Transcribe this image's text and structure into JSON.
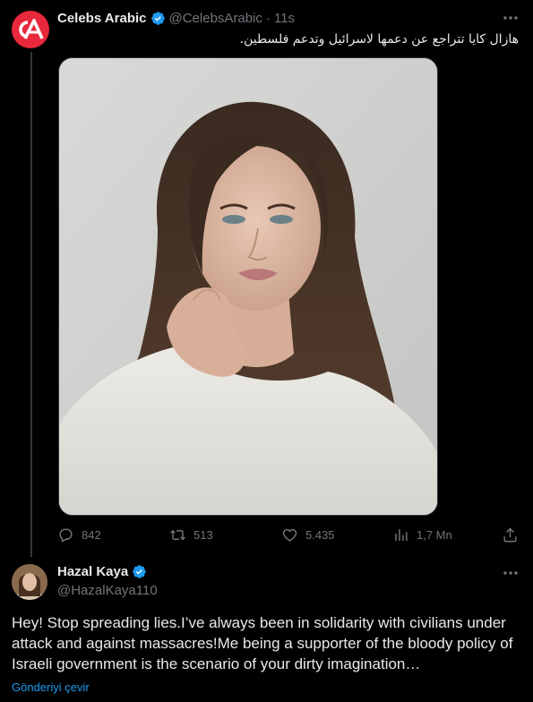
{
  "colors": {
    "background": "#000000",
    "text_primary": "#e7e9ea",
    "text_muted": "#71767b",
    "accent_blue": "#1d9bf0",
    "verified_badge": "#1d9bf0",
    "brand_red": "#e8283b"
  },
  "tweet": {
    "author_name": "Celebs Arabic",
    "author_handle": "@CelebsArabic",
    "separator": "·",
    "time": "11s",
    "avatar_logo_text": "CA",
    "text": "هازال كايا تتراجع عن دعمها لاسرائيل وتدعم فلسطين.",
    "media": {
      "alt": "Portrait photo of a woman with long brown hair in a cream sweater, hand at her chin"
    },
    "stats": {
      "replies": "842",
      "retweets": "513",
      "likes": "5.435",
      "views": "1,7 Mn"
    },
    "icons": {
      "reply": "reply-icon",
      "retweet": "retweet-icon",
      "like": "heart-icon",
      "views": "views-chart-icon",
      "share": "share-icon",
      "more": "more-horizontal-icon",
      "verified": "verified-badge-icon"
    }
  },
  "reply": {
    "author_name": "Hazal Kaya",
    "author_handle": "@HazalKaya110",
    "text": "Hey! Stop spreading lies.I’ve always been in solidarity with civilians under attack and against massacres!Me being a supporter of the bloody policy of Israeli government is the scenario of your dirty imagination…",
    "translate_label": "Gönderiyi çevir"
  }
}
